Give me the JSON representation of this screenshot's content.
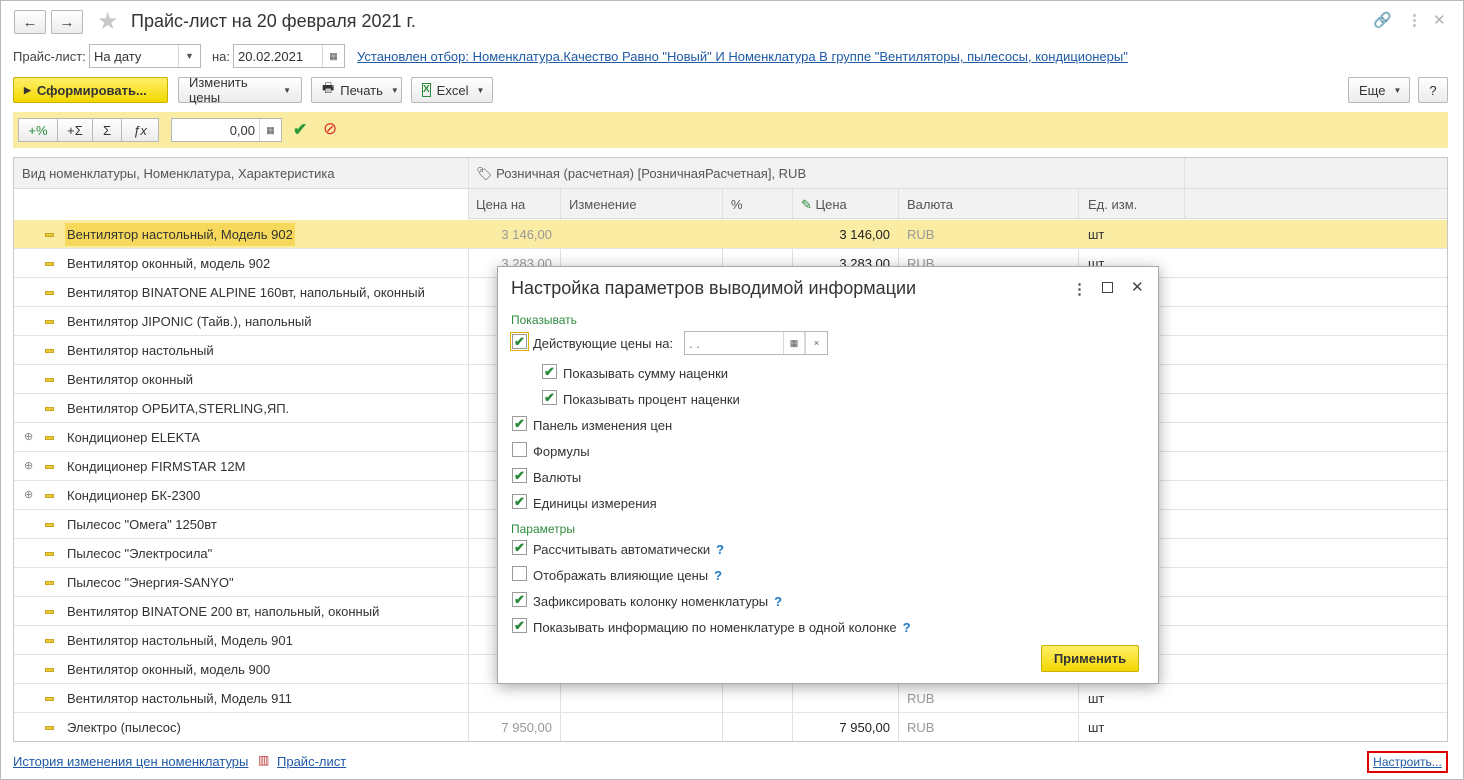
{
  "window": {
    "title": "Прайс-лист на 20 февраля 2021 г.",
    "back": "←",
    "forward": "→"
  },
  "filter": {
    "pricelist_label": "Прайс-лист:",
    "mode_value": "На дату",
    "on_label": "на:",
    "date_value": "20.02.2021",
    "filter_link": "Установлен отбор: Номенклатура.Качество Равно \"Новый\" И Номенклатура В группе \"Вентиляторы, пылесосы, кондиционеры\""
  },
  "toolbar": {
    "form": "Сформировать...",
    "change_prices": "Изменить цены",
    "print": "Печать",
    "excel": "Excel",
    "more": "Еще",
    "help": "?"
  },
  "price_panel": {
    "btn_pct": "+%",
    "btn_plus_sum": "+Σ",
    "btn_sum": "Σ",
    "btn_fx": "ƒx",
    "value": "0,00"
  },
  "grid": {
    "col_item": "Вид номенклатуры, Номенклатура, Характеристика",
    "group_header": "Розничная (расчетная) [РозничнаяРасчетная], RUB",
    "sub_cols": [
      "Цена на",
      "Изменение",
      "%",
      "Цена",
      "Валюта",
      "Ед. изм."
    ],
    "rows": [
      {
        "name": "Вентилятор настольный, Модель 902",
        "price_on": "3 146,00",
        "price": "3 146,00",
        "currency": "RUB",
        "unit": "шт"
      },
      {
        "name": "Вентилятор оконный, модель 902",
        "price_on": "3 283,00",
        "price": "3 283,00",
        "currency": "RUB",
        "unit": "шт"
      },
      {
        "name": "Вентилятор BINATONE ALPINE 160вт, напольный, оконный"
      },
      {
        "name": "Вентилятор JIPONIC (Тайв.), напольный"
      },
      {
        "name": "Вентилятор настольный"
      },
      {
        "name": "Вентилятор оконный"
      },
      {
        "name": "Вентилятор ОРБИТА,STERLING,ЯП."
      },
      {
        "name": "Кондиционер ELEKTA"
      },
      {
        "name": "Кондиционер FIRMSTAR 12М"
      },
      {
        "name": "Кондиционер БК-2300"
      },
      {
        "name": "Пылесос \"Омега\" 1250вт"
      },
      {
        "name": "Пылесос \"Электросила\""
      },
      {
        "name": "Пылесос \"Энергия-SANYO\""
      },
      {
        "name": "Вентилятор BINATONE 200 вт, напольный, оконный"
      },
      {
        "name": "Вентилятор настольный, Модель 901"
      },
      {
        "name": "Вентилятор оконный, модель 900"
      },
      {
        "name": "Вентилятор настольный, Модель 911",
        "currency": "RUB",
        "unit": "шт"
      },
      {
        "name": "Электро (пылесос)",
        "price_on": "7 950,00",
        "price": "7 950,00",
        "currency": "RUB",
        "unit": "шт"
      }
    ]
  },
  "dialog": {
    "title": "Настройка параметров выводимой информации",
    "section_show": "Показывать",
    "current_prices": "Действующие цены на:",
    "date_placeholder": " .  .",
    "show_markup_sum": "Показывать сумму наценки",
    "show_markup_pct": "Показывать процент наценки",
    "price_change_panel": "Панель изменения цен",
    "formulas": "Формулы",
    "currencies": "Валюты",
    "units": "Единицы измерения",
    "section_params": "Параметры",
    "auto_calc": "Рассчитывать автоматически",
    "show_affecting": "Отображать влияющие цены",
    "freeze_column": "Зафиксировать колонку номенклатуры",
    "one_column": "Показывать информацию по номенклатуре в одной колонке",
    "q": "?",
    "apply": "Применить"
  },
  "footer": {
    "history_link": "История изменения цен номенклатуры",
    "pricelist_link": "Прайс-лист",
    "configure_link": "Настроить..."
  }
}
